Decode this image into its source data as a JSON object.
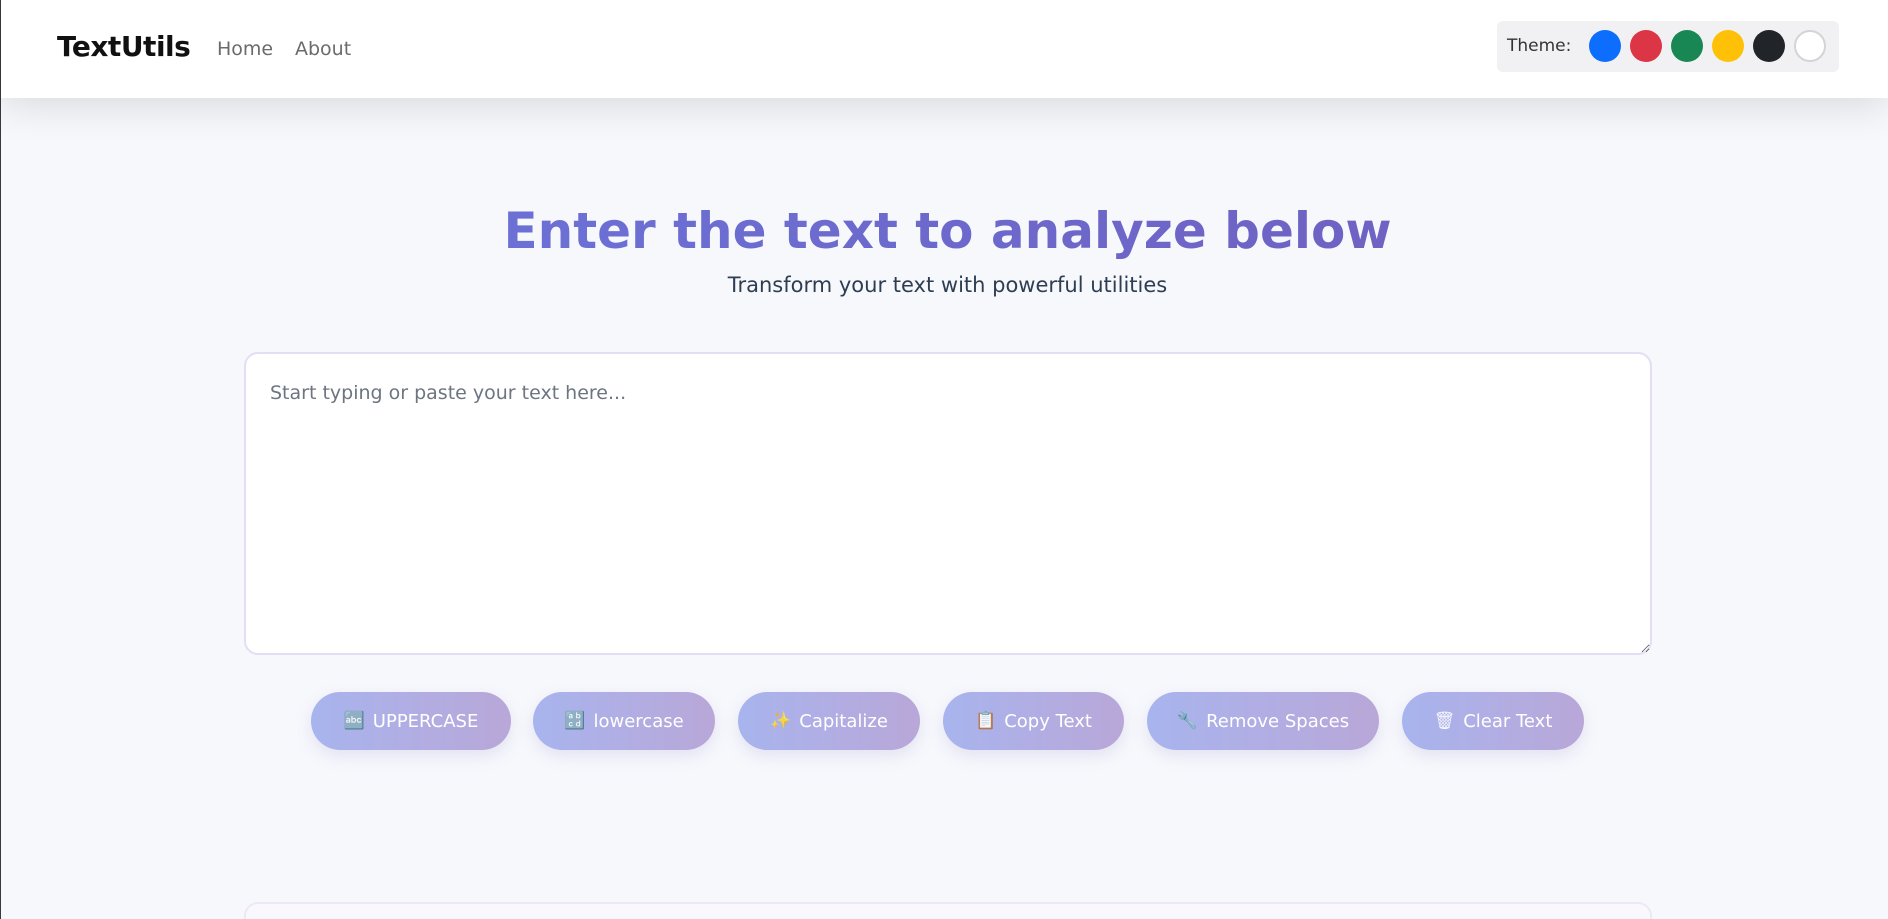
{
  "navbar": {
    "brand": "TextUtils",
    "links": [
      "Home",
      "About"
    ],
    "theme_label": "Theme:",
    "theme_colors": [
      "#0d6efd",
      "#dc3545",
      "#198754",
      "#ffc107",
      "#212529",
      "#ffffff"
    ]
  },
  "hero": {
    "title": "Enter the text to analyze below",
    "subtitle": "Transform your text with powerful utilities"
  },
  "editor": {
    "placeholder": "Start typing or paste your text here...",
    "value": ""
  },
  "actions": [
    {
      "icon": "abc-icon",
      "glyph": "🔤",
      "label": "UPPERCASE"
    },
    {
      "icon": "ab-icon",
      "glyph": "🔡",
      "label": "lowercase"
    },
    {
      "icon": "sparkles-icon",
      "glyph": "✨",
      "label": "Capitalize"
    },
    {
      "icon": "clipboard-icon",
      "glyph": "📋",
      "label": "Copy Text"
    },
    {
      "icon": "wrench-icon",
      "glyph": "🔧",
      "label": "Remove Spaces"
    },
    {
      "icon": "trash-icon",
      "glyph": "🗑",
      "label": "Clear Text"
    }
  ]
}
